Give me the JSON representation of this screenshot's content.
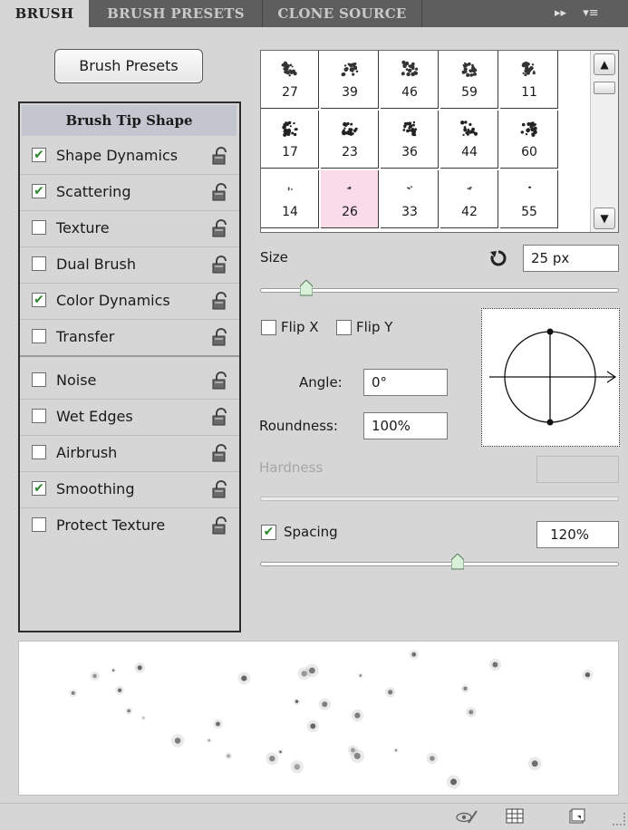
{
  "tabs": [
    {
      "label": "BRUSH",
      "active": true
    },
    {
      "label": "BRUSH PRESETS",
      "active": false
    },
    {
      "label": "CLONE SOURCE",
      "active": false
    }
  ],
  "panel_menu": {
    "forward": "▸▸",
    "menu": "▾≡"
  },
  "presets_button": "Brush Presets",
  "tip_shape_heading": "Brush Tip Shape",
  "options": [
    {
      "label": "Shape Dynamics",
      "checked": true
    },
    {
      "label": "Scattering",
      "checked": true
    },
    {
      "label": "Texture",
      "checked": false
    },
    {
      "label": "Dual Brush",
      "checked": false
    },
    {
      "label": "Color Dynamics",
      "checked": true
    },
    {
      "label": "Transfer",
      "checked": false
    },
    {
      "label": "Noise",
      "checked": false
    },
    {
      "label": "Wet Edges",
      "checked": false
    },
    {
      "label": "Airbrush",
      "checked": false
    },
    {
      "label": "Smoothing",
      "checked": true
    },
    {
      "label": "Protect Texture",
      "checked": false
    }
  ],
  "brush_sizes": [
    [
      "27",
      "39",
      "46",
      "59",
      "11"
    ],
    [
      "17",
      "23",
      "36",
      "44",
      "60"
    ],
    [
      "14",
      "26",
      "33",
      "42",
      "55"
    ]
  ],
  "selected_brush": "26",
  "size": {
    "label": "Size",
    "value": "25 px",
    "slider_fraction": 0.13
  },
  "flip_x": {
    "label": "Flip X",
    "checked": false
  },
  "flip_y": {
    "label": "Flip Y",
    "checked": false
  },
  "angle": {
    "label": "Angle:",
    "value": "0°"
  },
  "roundness": {
    "label": "Roundness:",
    "value": "100%"
  },
  "hardness": {
    "label": "Hardness",
    "value": ""
  },
  "spacing": {
    "label": "Spacing",
    "checked": true,
    "value": "120%",
    "slider_fraction": 0.55
  },
  "icons": {
    "reset": "reset-icon",
    "lock": "lock-icon",
    "eye": "visibility-brush-icon",
    "grid": "toggle-grid-icon",
    "new": "new-preset-icon"
  },
  "colors": {
    "panel": "#d6d6d6",
    "tabbar": "#5e5e5e",
    "selected": "#f9dce8",
    "heading": "#c3c6cf",
    "check": "#2c8a2c"
  }
}
